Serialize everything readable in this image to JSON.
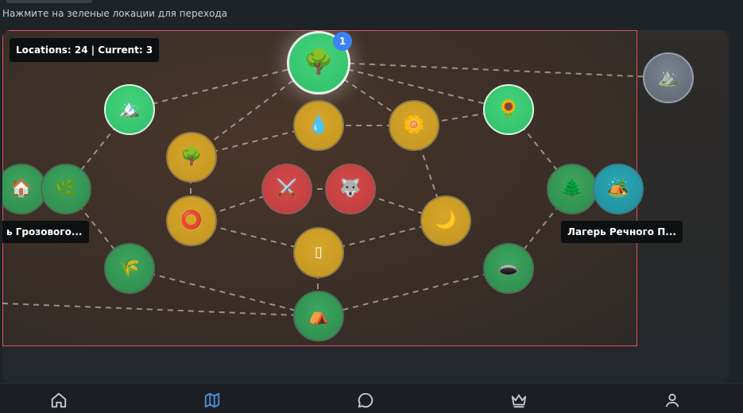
{
  "hint": "Нажмите на зеленые локации для перехода",
  "map": {
    "counter": "Locations: 24 | Current: 3",
    "current_badge": "1",
    "label_left": "ь Грозового...",
    "label_right": "Лагерь Речного П...",
    "nodes": [
      {
        "id": "forest-top",
        "icon": "tree-icon",
        "glyph": "🌳",
        "color": "bright",
        "state": "current"
      },
      {
        "id": "mountain-left",
        "icon": "mountain-icon",
        "glyph": "🏔️",
        "color": "bright"
      },
      {
        "id": "sunflower",
        "icon": "sunflower-icon",
        "glyph": "🌻",
        "color": "bright"
      },
      {
        "id": "mountain-far",
        "icon": "mountain-icon",
        "glyph": "⛰️",
        "color": "gray"
      },
      {
        "id": "water",
        "icon": "droplet-icon",
        "glyph": "💧",
        "color": "gold"
      },
      {
        "id": "flower",
        "icon": "flower-icon",
        "glyph": "🌼",
        "color": "gold"
      },
      {
        "id": "tree-mid",
        "icon": "tree-icon",
        "glyph": "🌳",
        "color": "gold"
      },
      {
        "id": "house",
        "icon": "house-icon",
        "glyph": "🏠",
        "color": "green"
      },
      {
        "id": "herb",
        "icon": "herb-icon",
        "glyph": "🌿",
        "color": "green"
      },
      {
        "id": "swords",
        "icon": "swords-icon",
        "glyph": "⚔️",
        "color": "red"
      },
      {
        "id": "wolf",
        "icon": "wolf-icon",
        "glyph": "🐺",
        "color": "red"
      },
      {
        "id": "ring",
        "icon": "ring-icon",
        "glyph": "⭕",
        "color": "gold"
      },
      {
        "id": "moon",
        "icon": "moon-icon",
        "glyph": "🌙",
        "color": "gold"
      },
      {
        "id": "pine",
        "icon": "pine-icon",
        "glyph": "🌲",
        "color": "green"
      },
      {
        "id": "camp",
        "icon": "camping-icon",
        "glyph": "🏕️",
        "color": "teal"
      },
      {
        "id": "unknown",
        "icon": "unknown-icon",
        "glyph": "▯",
        "color": "gold"
      },
      {
        "id": "wheat",
        "icon": "wheat-icon",
        "glyph": "🌾",
        "color": "green"
      },
      {
        "id": "hole",
        "icon": "hole-icon",
        "glyph": "🕳️",
        "color": "green"
      },
      {
        "id": "mound",
        "icon": "mound-icon",
        "glyph": "⛺",
        "color": "green"
      }
    ]
  },
  "nav": [
    {
      "id": "home",
      "icon": "home-icon",
      "active": false
    },
    {
      "id": "map",
      "icon": "map-icon",
      "active": true
    },
    {
      "id": "chat",
      "icon": "chat-icon",
      "active": false
    },
    {
      "id": "crown",
      "icon": "crown-icon",
      "active": false
    },
    {
      "id": "profile",
      "icon": "user-icon",
      "active": false
    }
  ],
  "colors": {
    "active_nav": "#4f8fdc",
    "inactive_nav": "#c9ced4"
  }
}
